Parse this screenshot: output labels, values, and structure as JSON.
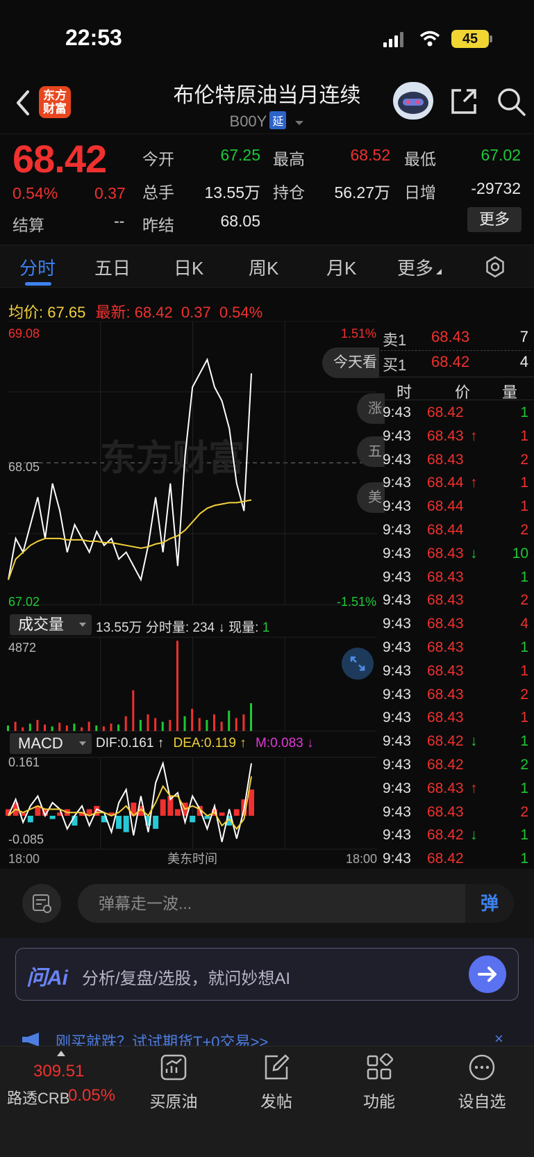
{
  "status_bar": {
    "time": "22:53",
    "battery": "45"
  },
  "header": {
    "logo_line1": "东方",
    "logo_line2": "财富",
    "title": "布伦特原油当月连续",
    "code": "B00Y",
    "delay_tag": "延"
  },
  "quote": {
    "last": "68.42",
    "pct": "0.54%",
    "change": "0.37",
    "settle_label": "结算",
    "settle": "--",
    "fields": [
      {
        "label": "今开",
        "value": "67.25",
        "color": "#1fc836"
      },
      {
        "label": "最高",
        "value": "68.52",
        "color": "#f0312f"
      },
      {
        "label": "最低",
        "value": "67.02",
        "color": "#1fc836"
      },
      {
        "label": "总手",
        "value": "13.55万",
        "color": "#e9e9e9"
      },
      {
        "label": "持仓",
        "value": "56.27万",
        "color": "#e9e9e9"
      },
      {
        "label": "日增",
        "value": "-29732",
        "color": "#e9e9e9"
      },
      {
        "label": "昨结",
        "value": "68.05",
        "color": "#e9e9e9"
      }
    ],
    "more_btn": "更多"
  },
  "tabs": [
    "分时",
    "五日",
    "日K",
    "周K",
    "月K",
    "更多"
  ],
  "info_line": {
    "avg_label": "均价:",
    "avg": "67.65",
    "latest_label": "最新:",
    "latest": "68.42",
    "change": "0.37",
    "pct": "0.54%"
  },
  "chart_data": {
    "type": "line",
    "price_axis": {
      "high": "69.08",
      "mid": "68.05",
      "low": "67.02"
    },
    "pct_axis": {
      "high": "1.51%",
      "low": "-1.51%"
    },
    "time_axis": {
      "start": "18:00",
      "label": "美东时间",
      "end": "18:00"
    },
    "watermark": "东方财富",
    "series": [
      {
        "name": "price",
        "values": [
          67.2,
          67.5,
          67.4,
          67.6,
          67.8,
          67.5,
          67.9,
          67.7,
          67.4,
          67.6,
          67.5,
          67.4,
          67.55,
          67.45,
          67.5,
          67.35,
          67.4,
          67.3,
          67.2,
          67.45,
          67.8,
          67.4,
          67.9,
          67.3,
          68.1,
          68.6,
          68.7,
          68.8,
          68.6,
          68.5,
          68.3,
          67.9,
          67.7,
          68.7
        ]
      },
      {
        "name": "avg",
        "values": [
          67.2,
          67.35,
          67.4,
          67.45,
          67.48,
          67.5,
          67.5,
          67.5,
          67.49,
          67.49,
          67.49,
          67.48,
          67.48,
          67.47,
          67.47,
          67.46,
          67.45,
          67.44,
          67.43,
          67.44,
          67.46,
          67.47,
          67.5,
          67.52,
          67.56,
          67.62,
          67.68,
          67.72,
          67.74,
          67.75,
          67.76,
          67.76,
          67.77,
          67.78
        ]
      }
    ],
    "volume": {
      "label": "成交量",
      "info": "13.55万 分时量: 234 ↓ 现量: ",
      "current": "1",
      "max_label": "4872",
      "bars": [
        300,
        500,
        200,
        400,
        600,
        350,
        250,
        450,
        300,
        400,
        200,
        500,
        300,
        250,
        400,
        350,
        800,
        2200,
        600,
        900,
        700,
        500,
        600,
        4872,
        800,
        1200,
        700,
        600,
        900,
        500,
        1100,
        700,
        900,
        1500
      ]
    },
    "macd": {
      "label": "MACD",
      "dif": "DIF:0.161 ↑",
      "dea": "DEA:0.119 ↑",
      "m": "M:0.083 ↓",
      "max_label": "0.161",
      "min_label": "-0.085",
      "hist": [
        0.02,
        0.04,
        0.01,
        -0.02,
        0.03,
        0.02,
        -0.01,
        0.01,
        0.02,
        -0.03,
        0.01,
        0.02,
        0.03,
        -0.02,
        0.01,
        -0.04,
        -0.05,
        0.04,
        0.03,
        -0.03,
        -0.04,
        0.05,
        0.06,
        0.02,
        0.04,
        -0.02,
        0.03,
        -0.01,
        0.02,
        0.01,
        -0.03,
        0.02,
        0.05,
        0.08
      ],
      "dif_line": [
        0.0,
        0.05,
        -0.02,
        0.03,
        0.06,
        0.0,
        0.04,
        0.02,
        -0.04,
        0.0,
        0.03,
        -0.03,
        0.02,
        0.01,
        -0.05,
        0.04,
        0.08,
        -0.06,
        0.06,
        -0.05,
        0.1,
        0.16,
        0.05,
        0.07,
        -0.02,
        0.06,
        0.02,
        -0.04,
        0.03,
        -0.08,
        0.02,
        -0.07,
        0.02,
        0.16
      ],
      "dea_line": [
        0.0,
        0.02,
        0.01,
        0.02,
        0.03,
        0.02,
        0.02,
        0.02,
        0.01,
        0.01,
        0.01,
        0.0,
        0.01,
        0.01,
        0.0,
        0.01,
        0.03,
        0.0,
        0.02,
        0.0,
        0.04,
        0.09,
        0.06,
        0.06,
        0.02,
        0.03,
        0.02,
        0.0,
        0.01,
        -0.03,
        -0.01,
        -0.04,
        -0.01,
        0.12
      ]
    },
    "colors": {
      "price": "#ffffff",
      "avg": "#f2d13b",
      "up": "#f0312f",
      "down": "#1fc836",
      "hist_neg": "#27c9d6"
    }
  },
  "chart_bubbles": {
    "today": "今天看",
    "b1": "涨",
    "b2": "五",
    "b3": "美"
  },
  "order_book": {
    "ask": {
      "label": "卖1",
      "price": "68.43",
      "qty": "7"
    },
    "bid": {
      "label": "买1",
      "price": "68.42",
      "qty": "4"
    }
  },
  "ticks_header": {
    "time": "时",
    "price": "价",
    "qty": "量"
  },
  "ticks": [
    {
      "t": "9:43",
      "p": "68.42",
      "arrow": "",
      "q": "1",
      "qc": "green"
    },
    {
      "t": "9:43",
      "p": "68.43",
      "arrow": "↑",
      "q": "1",
      "qc": "red"
    },
    {
      "t": "9:43",
      "p": "68.43",
      "arrow": "",
      "q": "2",
      "qc": "red"
    },
    {
      "t": "9:43",
      "p": "68.44",
      "arrow": "↑",
      "q": "1",
      "qc": "red"
    },
    {
      "t": "9:43",
      "p": "68.44",
      "arrow": "",
      "q": "1",
      "qc": "red"
    },
    {
      "t": "9:43",
      "p": "68.44",
      "arrow": "",
      "q": "2",
      "qc": "red"
    },
    {
      "t": "9:43",
      "p": "68.43",
      "arrow": "↓",
      "q": "10",
      "qc": "green"
    },
    {
      "t": "9:43",
      "p": "68.43",
      "arrow": "",
      "q": "1",
      "qc": "green"
    },
    {
      "t": "9:43",
      "p": "68.43",
      "arrow": "",
      "q": "2",
      "qc": "red"
    },
    {
      "t": "9:43",
      "p": "68.43",
      "arrow": "",
      "q": "4",
      "qc": "red"
    },
    {
      "t": "9:43",
      "p": "68.43",
      "arrow": "",
      "q": "1",
      "qc": "green"
    },
    {
      "t": "9:43",
      "p": "68.43",
      "arrow": "",
      "q": "1",
      "qc": "red"
    },
    {
      "t": "9:43",
      "p": "68.43",
      "arrow": "",
      "q": "2",
      "qc": "red"
    },
    {
      "t": "9:43",
      "p": "68.43",
      "arrow": "",
      "q": "1",
      "qc": "red"
    },
    {
      "t": "9:43",
      "p": "68.42",
      "arrow": "↓",
      "q": "1",
      "qc": "green"
    },
    {
      "t": "9:43",
      "p": "68.42",
      "arrow": "",
      "q": "2",
      "qc": "green"
    },
    {
      "t": "9:43",
      "p": "68.43",
      "arrow": "↑",
      "q": "1",
      "qc": "green"
    },
    {
      "t": "9:43",
      "p": "68.43",
      "arrow": "",
      "q": "2",
      "qc": "red"
    },
    {
      "t": "9:43",
      "p": "68.42",
      "arrow": "↓",
      "q": "1",
      "qc": "green"
    },
    {
      "t": "9:43",
      "p": "68.42",
      "arrow": "",
      "q": "1",
      "qc": "green"
    }
  ],
  "comment": {
    "placeholder": "弹幕走一波...",
    "send": "弹"
  },
  "ai": {
    "logo": "问Ai",
    "text": "分析/复盘/选股，就问妙想AI"
  },
  "promo": {
    "text": "刚买就跌？试试期货T+0交易>>",
    "close": "×"
  },
  "bottom_nav": {
    "index_value": "309.51",
    "index_name": "路透CRB",
    "index_pct": "0.05%",
    "items": [
      {
        "label": "买原油",
        "icon": "chart-box-icon"
      },
      {
        "label": "发帖",
        "icon": "edit-icon"
      },
      {
        "label": "功能",
        "icon": "grid-icon"
      },
      {
        "label": "设自选",
        "icon": "more-circle-icon"
      }
    ]
  }
}
